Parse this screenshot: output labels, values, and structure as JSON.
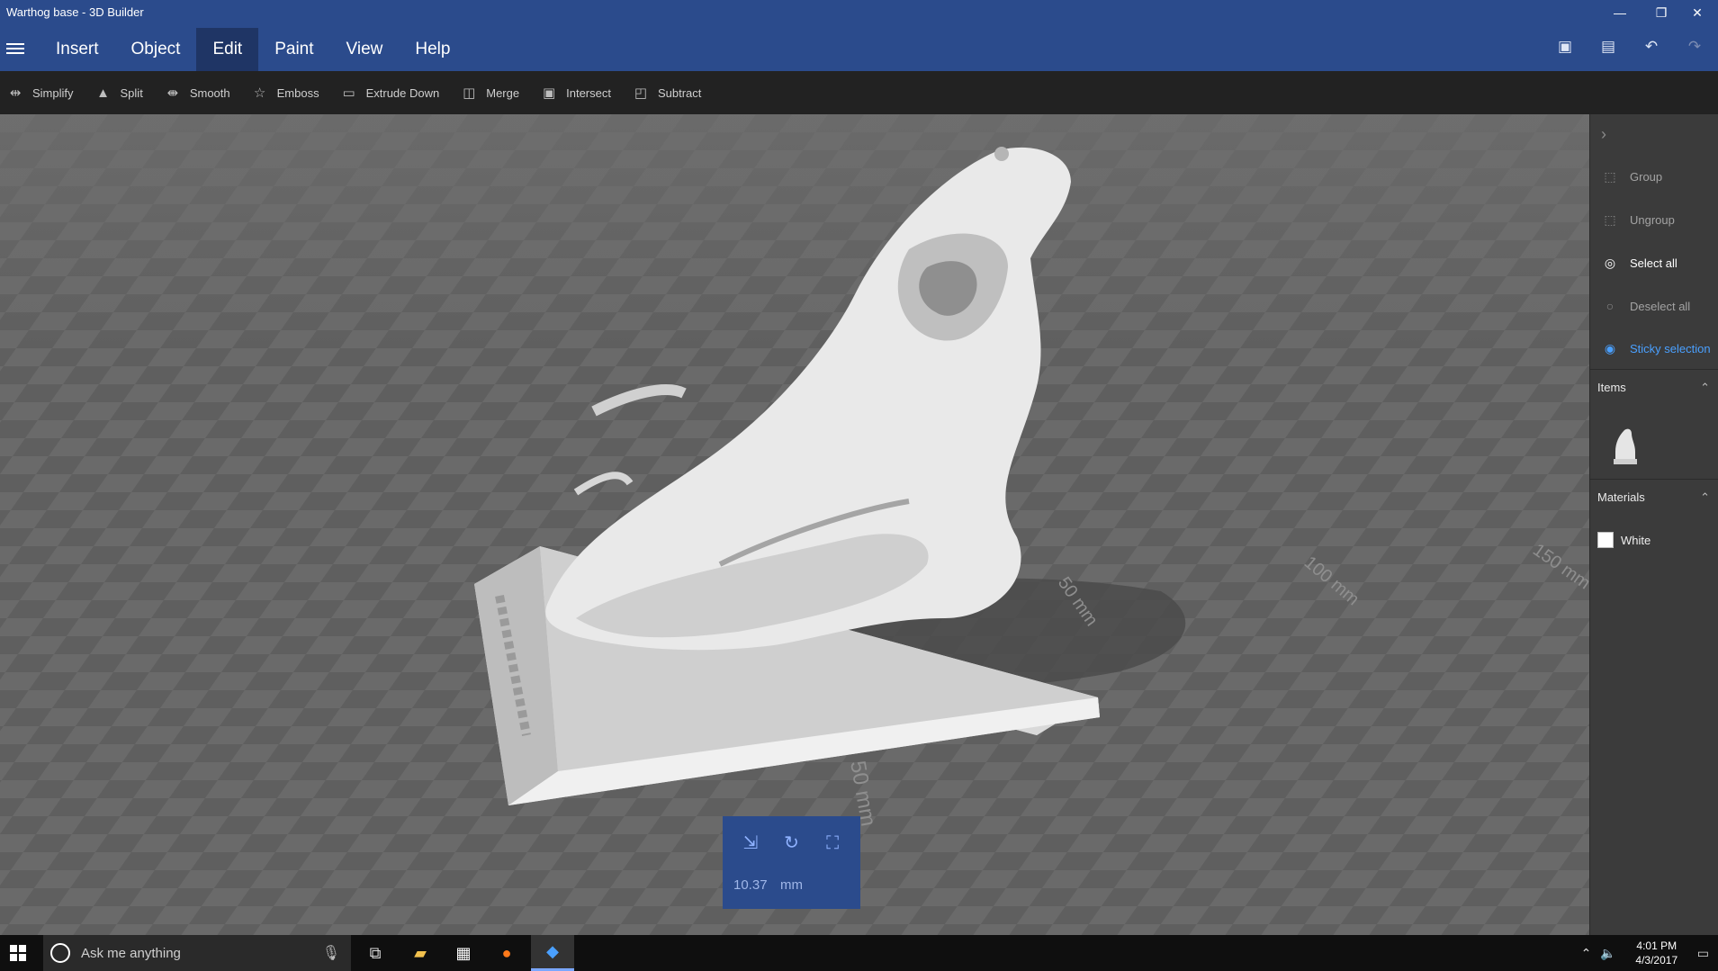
{
  "window": {
    "title": "Warthog base - 3D Builder",
    "minimize": "—",
    "restore": "❐",
    "close": "✕"
  },
  "menu": {
    "items": [
      "Insert",
      "Object",
      "Edit",
      "Paint",
      "View",
      "Help"
    ],
    "active": "Edit"
  },
  "toolbar": {
    "items": [
      {
        "label": "Simplify",
        "icon": "simplify-icon"
      },
      {
        "label": "Split",
        "icon": "split-icon"
      },
      {
        "label": "Smooth",
        "icon": "smooth-icon"
      },
      {
        "label": "Emboss",
        "icon": "emboss-icon"
      },
      {
        "label": "Extrude Down",
        "icon": "extrude-down-icon"
      },
      {
        "label": "Merge",
        "icon": "merge-icon"
      },
      {
        "label": "Intersect",
        "icon": "intersect-icon"
      },
      {
        "label": "Subtract",
        "icon": "subtract-icon"
      }
    ]
  },
  "viewport": {
    "ruler_labels": [
      "50 mm",
      "100 mm",
      "150 mm",
      "50 mm"
    ],
    "gizmo": {
      "value": "10.37",
      "unit": "mm"
    }
  },
  "side_panel": {
    "actions": [
      {
        "label": "Group",
        "state": "disabled"
      },
      {
        "label": "Ungroup",
        "state": "disabled"
      },
      {
        "label": "Select all",
        "state": "enabled"
      },
      {
        "label": "Deselect all",
        "state": "disabled"
      },
      {
        "label": "Sticky selection",
        "state": "active"
      }
    ],
    "items_header": "Items",
    "materials_header": "Materials",
    "material": "White"
  },
  "taskbar": {
    "search_placeholder": "Ask me anything",
    "time": "4:01 PM",
    "date": "4/3/2017"
  },
  "colors": {
    "accent": "#2b4b8c",
    "sticky": "#4aa0ff",
    "toolbar": "#222222",
    "panel": "#3b3b3b"
  }
}
